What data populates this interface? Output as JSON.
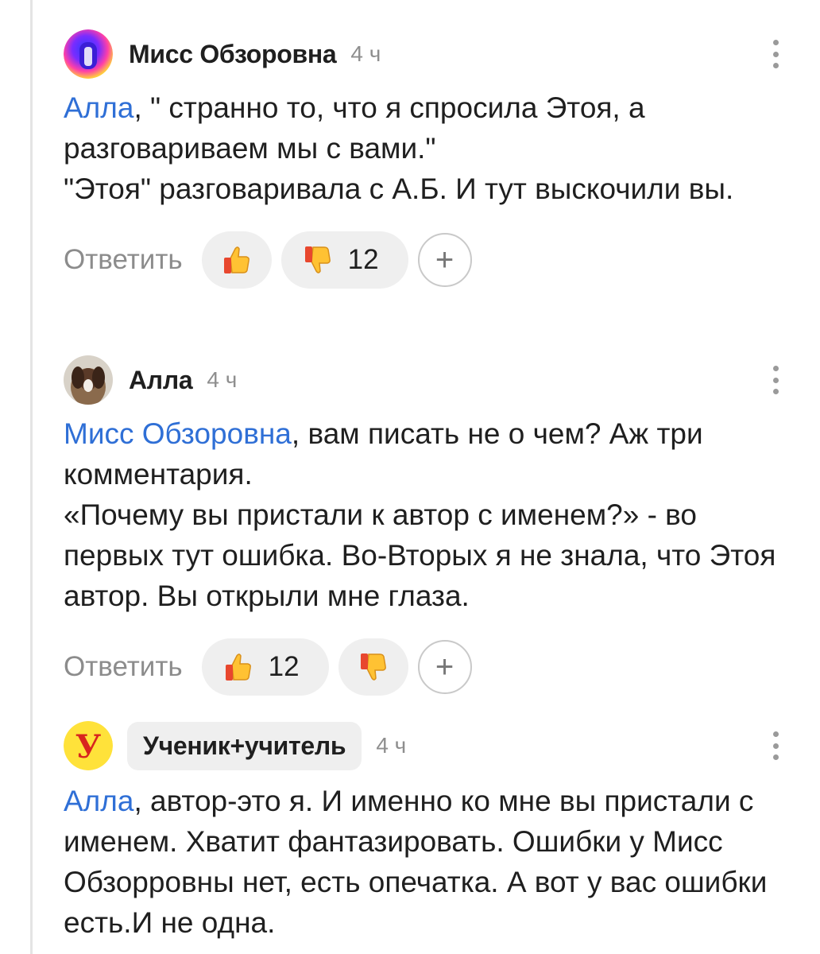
{
  "comments": [
    {
      "author": "Мисс Обзоровна",
      "time": "4 ч",
      "mention": "Алла",
      "text_after_mention": ", \" странно то, что я спросила Этоя, а разговариваем мы с вами.\"",
      "lines": [
        "\"Этоя\" разговаривала с А.Б. И тут выскочили вы."
      ],
      "reply_label": "Ответить",
      "likes": "",
      "dislikes": "12"
    },
    {
      "author": "Алла",
      "time": "4 ч",
      "mention": "Мисс Обзоровна",
      "text_after_mention": ", вам писать не о чем? Аж три комментария.",
      "lines": [
        "«Почему вы пристали к автор с именем?» - во первых тут ошибка. Во-Вторых я не знала, что Этоя автор. Вы открыли мне глаза."
      ],
      "reply_label": "Ответить",
      "likes": "12",
      "dislikes": ""
    },
    {
      "author": "Ученик+учитель",
      "time": "4 ч",
      "mention": "Алла",
      "text_after_mention": ", автор-это я. И именно ко мне вы пристали с именем. Хватит фантазировать. Ошибки у Мисс Обзорровны нет, есть опечатка. А вот у вас ошибки есть.И не одна.",
      "lines": []
    }
  ],
  "icons": {
    "like": "thumbs-up-icon",
    "dislike": "thumbs-down-icon",
    "add": "plus-icon",
    "more": "kebab-menu-icon"
  },
  "colors": {
    "mention": "#2f6fd6",
    "muted": "#8e8e8e",
    "pill": "#efefef"
  },
  "plus_symbol": "+"
}
